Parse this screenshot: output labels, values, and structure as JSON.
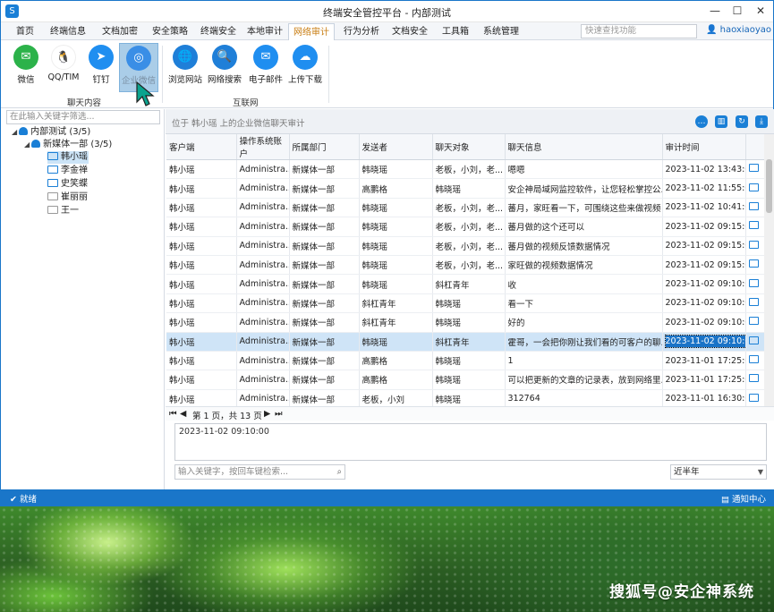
{
  "window": {
    "title": "终端安全管控平台 - 内部测试",
    "logo": "S",
    "controls": {
      "min": "—",
      "max": "☐",
      "close": "✕"
    }
  },
  "menu": {
    "items": [
      "首页",
      "终端信息",
      "文档加密",
      "安全策略",
      "终端安全",
      "本地审计",
      "网络审计",
      "行为分析",
      "文档安全",
      "工具箱",
      "系统管理"
    ],
    "active": "网络审计",
    "search_placeholder": "快速查找功能",
    "user": "haoxiaoyao ▾"
  },
  "ribbon": {
    "groups": [
      {
        "label": "聊天内容"
      },
      {
        "label": "互联网"
      }
    ],
    "buttons": [
      {
        "label": "微信",
        "icon": "wechat-icon",
        "glyph": "✉",
        "color": "#2cb24a"
      },
      {
        "label": "QQ/TIM",
        "icon": "qq-icon",
        "glyph": "🐧",
        "color": "#ffffff"
      },
      {
        "label": "钉钉",
        "icon": "dingtalk-icon",
        "glyph": "➤",
        "color": "#1f8ef0"
      },
      {
        "label": "企业微信",
        "icon": "wecom-icon",
        "glyph": "◎",
        "color": "#3a8ee6"
      },
      {
        "label": "浏览网站",
        "icon": "browse-web-icon",
        "glyph": "🌐",
        "color": "#1f7fd8"
      },
      {
        "label": "网络搜索",
        "icon": "web-search-icon",
        "glyph": "🔍",
        "color": "#1f7fd8"
      },
      {
        "label": "电子邮件",
        "icon": "email-icon",
        "glyph": "✉",
        "color": "#1f8ef0"
      },
      {
        "label": "上传下载",
        "icon": "upload-download-icon",
        "glyph": "☁",
        "color": "#1f8ef0"
      }
    ]
  },
  "sidebar": {
    "search_placeholder": "在此输入关键字筛选...",
    "tree": [
      {
        "label": "内部测试 (3/5)",
        "toggle": "◢",
        "kind": "group"
      },
      {
        "label": "新媒体一部 (3/5)",
        "toggle": "◢",
        "kind": "group"
      },
      {
        "label": "韩小瑶",
        "kind": "pc",
        "online": true,
        "selected": true
      },
      {
        "label": "李金禅",
        "kind": "pc",
        "online": true
      },
      {
        "label": "史笑蝶",
        "kind": "pc",
        "online": true
      },
      {
        "label": "崔丽丽",
        "kind": "pc",
        "online": false
      },
      {
        "label": "王一",
        "kind": "pc",
        "online": false
      }
    ]
  },
  "content": {
    "breadcrumb": "位于 韩小瑶 上的企业微信聊天审计",
    "toolbar_icons": [
      {
        "name": "chat-icon",
        "glyph": "…"
      },
      {
        "name": "columns-icon",
        "glyph": "▥"
      },
      {
        "name": "refresh-icon",
        "glyph": "↻"
      },
      {
        "name": "download-icon",
        "glyph": "⤓"
      }
    ],
    "columns": [
      "客户端",
      "操作系统账户",
      "所属部门",
      "发送者",
      "聊天对象",
      "聊天信息",
      "审计时间"
    ],
    "rows": [
      [
        "韩小瑶",
        "Administra...",
        "新媒体一部",
        "韩晓瑶",
        "老板，小刘，老...",
        "嗯嗯",
        "2023-11-02 13:43:00"
      ],
      [
        "韩小瑶",
        "Administra...",
        "新媒体一部",
        "高鹏格",
        "韩晓瑶",
        "安企神局域网监控软件，让您轻松掌控公...",
        "2023-11-02 11:55:00"
      ],
      [
        "韩小瑶",
        "Administra...",
        "新媒体一部",
        "韩晓瑶",
        "老板，小刘，老...",
        "蕃月，家旺看一下，可围绕这些来做视频",
        "2023-11-02 10:41:00"
      ],
      [
        "韩小瑶",
        "Administra...",
        "新媒体一部",
        "韩晓瑶",
        "老板，小刘，老...",
        "蕃月做的这个还可以",
        "2023-11-02 09:15:00"
      ],
      [
        "韩小瑶",
        "Administra...",
        "新媒体一部",
        "韩晓瑶",
        "老板，小刘，老...",
        "蕃月做的视频反馈数据情况",
        "2023-11-02 09:15:00"
      ],
      [
        "韩小瑶",
        "Administra...",
        "新媒体一部",
        "韩晓瑶",
        "老板，小刘，老...",
        "家旺做的视频数据情况",
        "2023-11-02 09:15:00"
      ],
      [
        "韩小瑶",
        "Administra...",
        "新媒体一部",
        "韩晓瑶",
        "斜杠青年",
        "收",
        "2023-11-02 09:10:00"
      ],
      [
        "韩小瑶",
        "Administra...",
        "新媒体一部",
        "斜杠青年",
        "韩晓瑶",
        "看一下",
        "2023-11-02 09:10:00"
      ],
      [
        "韩小瑶",
        "Administra...",
        "新媒体一部",
        "斜杠青年",
        "韩晓瑶",
        "好的",
        "2023-11-02 09:10:00"
      ],
      [
        "韩小瑶",
        "Administra...",
        "新媒体一部",
        "韩晓瑶",
        "斜杠青年",
        "霍哥，一会把你刚让我们看的可客户的聊...",
        "2023-11-02 09:10:00"
      ],
      [
        "韩小瑶",
        "Administra...",
        "新媒体一部",
        "高鹏格",
        "韩晓瑶",
        "1",
        "2023-11-01 17:25:00"
      ],
      [
        "韩小瑶",
        "Administra...",
        "新媒体一部",
        "高鹏格",
        "韩晓瑶",
        "可以把更新的文章的记录表，放到网络里...",
        "2023-11-01 17:25:00"
      ],
      [
        "韩小瑶",
        "Administra...",
        "新媒体一部",
        "老板，小刘",
        "韩晓瑶",
        "312764",
        "2023-11-01 16:30:00"
      ]
    ],
    "selected_row": 9,
    "pager": {
      "first": "⏮",
      "prev": "◀",
      "text": "第 1 页，共 13 页",
      "next": "▶",
      "last": "⏭"
    },
    "detail": "2023-11-02 09:10:00",
    "keyword_placeholder": "输入关键字，按回车键检索...",
    "range": "近半年"
  },
  "status": {
    "left": "就绪",
    "left_icon": "✔",
    "right": "通知中心",
    "right_icon": "▤"
  },
  "watermark": "搜狐号@安企神系统",
  "colors": {
    "accent": "#1a76c9",
    "active_menu": "#c87c10",
    "row_highlight": "#cfe4f7"
  }
}
